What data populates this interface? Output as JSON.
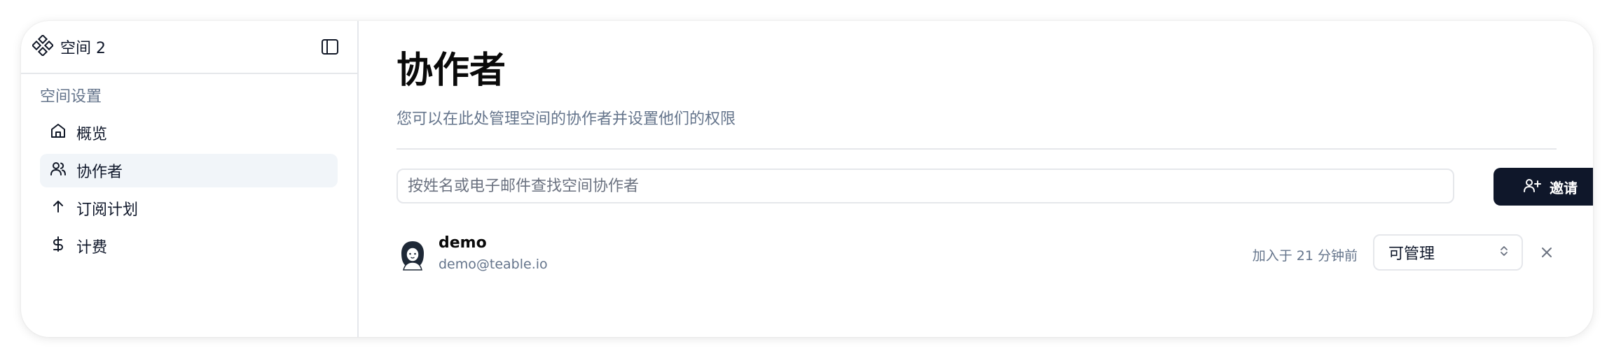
{
  "sidebar": {
    "space_name": "空间 2",
    "section_label": "空间设置",
    "items": [
      {
        "label": "概览",
        "icon": "home-icon"
      },
      {
        "label": "协作者",
        "icon": "users-icon",
        "active": true
      },
      {
        "label": "订阅计划",
        "icon": "arrow-up-icon"
      },
      {
        "label": "计费",
        "icon": "dollar-icon"
      }
    ]
  },
  "main": {
    "title": "协作者",
    "description": "您可以在此处管理空间的协作者并设置他们的权限",
    "search_placeholder": "按姓名或电子邮件查找空间协作者",
    "invite_label": "邀请",
    "members": [
      {
        "name": "demo",
        "email": "demo@teable.io",
        "joined": "加入于 21 分钟前",
        "role": "可管理",
        "avatar_icon": "avatar-icon"
      }
    ]
  },
  "colors": {
    "primary": "#0f172a",
    "muted_text": "#64748b",
    "border": "#e5e7eb",
    "active_bg": "#f1f5f9"
  }
}
